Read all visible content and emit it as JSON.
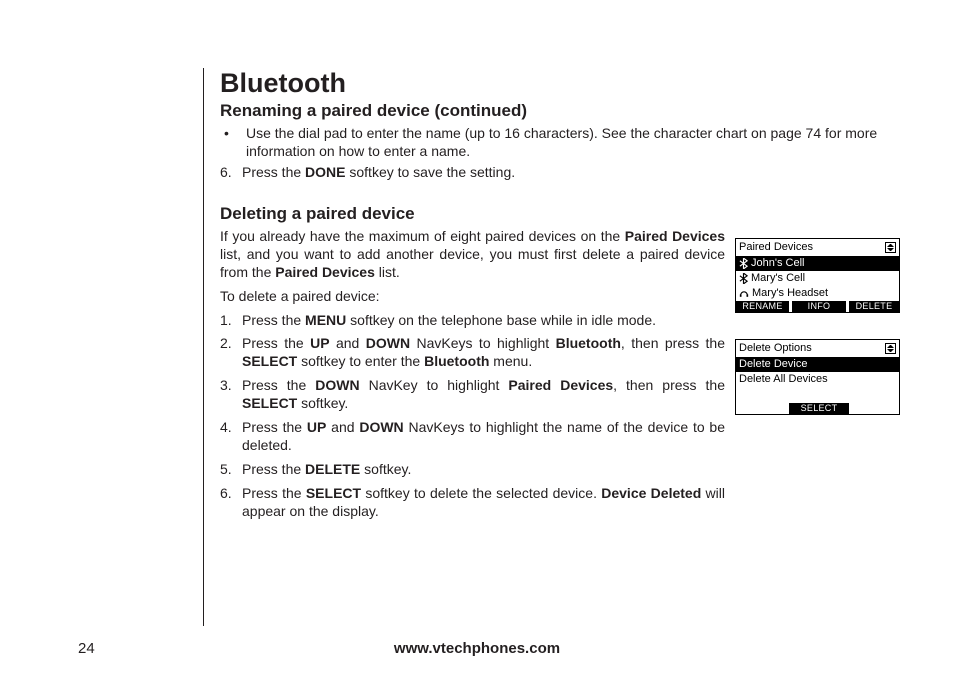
{
  "page": {
    "number": "24",
    "footer_url": "www.vtechphones.com"
  },
  "headings": {
    "h1": "Bluetooth",
    "h2a": "Renaming a paired device (continued)",
    "h2b": "Deleting a paired device"
  },
  "rename_section": {
    "bullet1_pre": "Use the dial pad to enter the name (up to 16 characters). See the character chart on page 74 for more information on how to enter a name.",
    "step6_num": "6.",
    "step6_a": "Press the ",
    "step6_b": "DONE",
    "step6_c": " softkey to save the setting."
  },
  "delete_section": {
    "intro_a": "If you already have the maximum of eight paired devices on the ",
    "intro_b": "Paired Devices",
    "intro_c": " list, and you want to add another device, you must first delete a paired device from the ",
    "intro_d": "Paired Devices",
    "intro_e": " list.",
    "lead": "To delete a paired device:",
    "s1_num": "1.",
    "s1_a": "Press the ",
    "s1_b": "MENU",
    "s1_c": " softkey on the telephone base while in idle mode.",
    "s2_num": "2.",
    "s2_a": "Press the ",
    "s2_b": "UP",
    "s2_c": " and ",
    "s2_d": "DOWN",
    "s2_e": " NavKeys to highlight ",
    "s2_f": "Bluetooth",
    "s2_g": ", then press the ",
    "s2_h": "SELECT",
    "s2_i": " softkey to enter the ",
    "s2_j": "Bluetooth",
    "s2_k": " menu.",
    "s3_num": "3.",
    "s3_a": "Press the ",
    "s3_b": "DOWN",
    "s3_c": " NavKey to highlight ",
    "s3_d": "Paired Devices",
    "s3_e": ", then press the ",
    "s3_f": "SELECT",
    "s3_g": " softkey.",
    "s4_num": "4.",
    "s4_a": "Press the ",
    "s4_b": "UP",
    "s4_c": " and ",
    "s4_d": "DOWN",
    "s4_e": " NavKeys to highlight the name of the device to be deleted.",
    "s5_num": "5.",
    "s5_a": "Press the ",
    "s5_b": "DELETE",
    "s5_c": " softkey.",
    "s6_num": "6.",
    "s6_a": "Press the ",
    "s6_b": "SELECT",
    "s6_c": " softkey to delete the selected device. ",
    "s6_d": "Device Deleted",
    "s6_e": " will appear on the display."
  },
  "lcd1": {
    "title": "Paired Devices",
    "item1": "John's Cell",
    "item2": "Mary's Cell",
    "item3": "Mary's Headset",
    "sk_left": "RENAME",
    "sk_center": "INFO",
    "sk_right": "DELETE"
  },
  "lcd2": {
    "title": "Delete Options",
    "item1": "Delete Device",
    "item2": "Delete All Devices",
    "sk_center": "SELECT"
  }
}
